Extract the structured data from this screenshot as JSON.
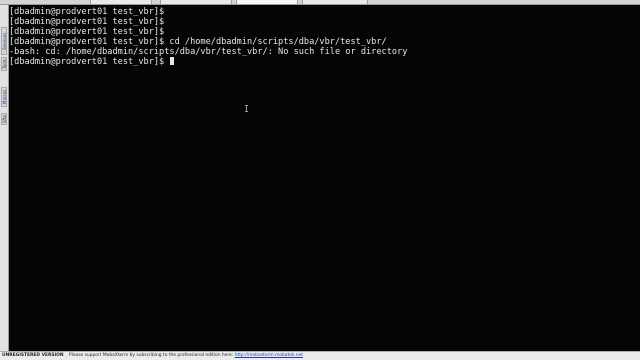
{
  "sidebar": {
    "tabs": [
      {
        "label": "Sessions"
      },
      {
        "label": "Tools"
      },
      {
        "label": "Macros"
      },
      {
        "label": "Sftp"
      }
    ]
  },
  "terminal": {
    "lines": [
      "[dbadmin@prodvert01 test_vbr]$",
      "[dbadmin@prodvert01 test_vbr]$",
      "[dbadmin@prodvert01 test_vbr]$",
      "[dbadmin@prodvert01 test_vbr]$ cd /home/dbadmin/scripts/dba/vbr/test_vbr/",
      "-bash: cd: /home/dbadmin/scripts/dba/vbr/test_vbr/: No such file or directory",
      "[dbadmin@prodvert01 test_vbr]$ "
    ]
  },
  "statusbar": {
    "unregistered": "UNREGISTERED VERSION",
    "message": "Please support MobaXterm by subscribing to the professional edition here:",
    "link": "http://mobaxterm.mobatek.net"
  }
}
